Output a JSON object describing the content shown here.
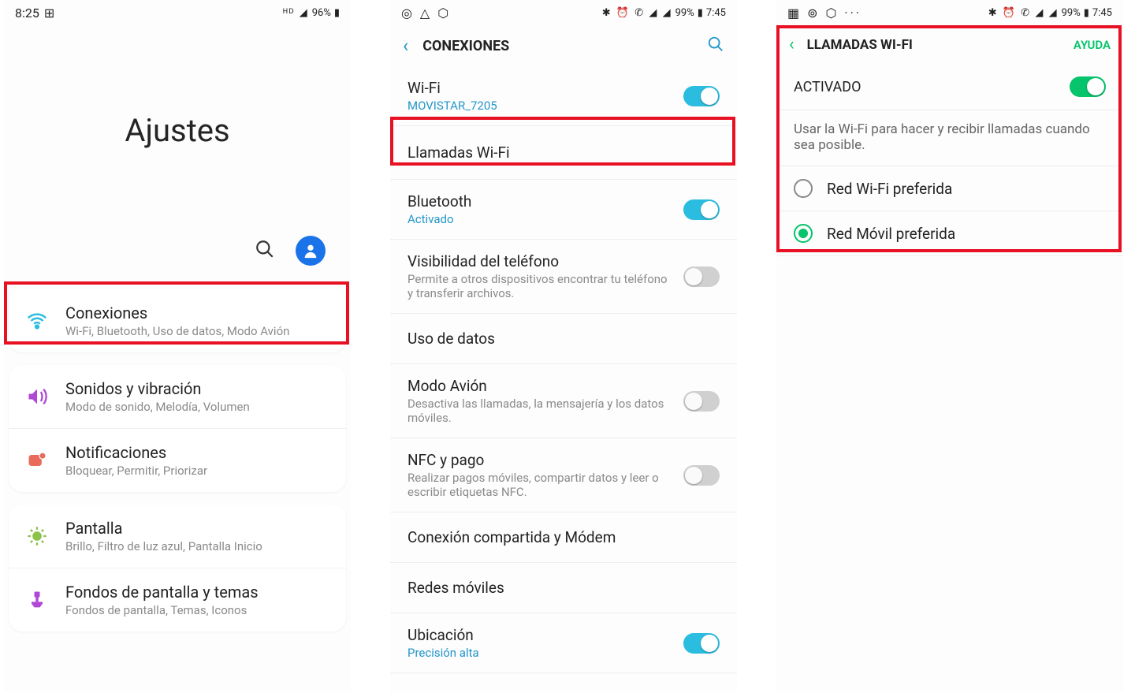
{
  "phone1": {
    "status": {
      "time": "8:25",
      "battery": "96%"
    },
    "title": "Ajustes",
    "items": [
      {
        "title": "Conexiones",
        "sub": "Wi-Fi, Bluetooth, Uso de datos, Modo Avión"
      },
      {
        "title": "Sonidos y vibración",
        "sub": "Modo de sonido, Melodía, Volumen"
      },
      {
        "title": "Notificaciones",
        "sub": "Bloquear, Permitir, Priorizar"
      },
      {
        "title": "Pantalla",
        "sub": "Brillo, Filtro de luz azul, Pantalla Inicio"
      },
      {
        "title": "Fondos de pantalla y temas",
        "sub": "Fondos de pantalla, Temas, Iconos"
      }
    ]
  },
  "phone2": {
    "status": {
      "battery": "99%",
      "time": "7:45"
    },
    "header": "CONEXIONES",
    "items": [
      {
        "title": "Wi-Fi",
        "sub": "MOVISTAR_7205",
        "accent": true,
        "toggle": "on"
      },
      {
        "title": "Llamadas Wi-Fi"
      },
      {
        "title": "Bluetooth",
        "sub": "Activado",
        "accent": true,
        "toggle": "on"
      },
      {
        "title": "Visibilidad del teléfono",
        "sub": "Permite a otros dispositivos encontrar tu teléfono y transferir archivos.",
        "toggle": "off"
      },
      {
        "title": "Uso de datos"
      },
      {
        "title": "Modo Avión",
        "sub": "Desactiva las llamadas, la mensajería y los datos móviles.",
        "toggle": "off"
      },
      {
        "title": "NFC y pago",
        "sub": "Realizar pagos móviles, compartir datos y leer o escribir etiquetas NFC.",
        "toggle": "off"
      },
      {
        "title": "Conexión compartida y Módem"
      },
      {
        "title": "Redes móviles"
      },
      {
        "title": "Ubicación",
        "sub": "Precisión alta",
        "accent": true,
        "toggle": "on"
      }
    ]
  },
  "phone3": {
    "status": {
      "battery": "99%",
      "time": "7:45"
    },
    "header": "LLAMADAS WI-FI",
    "help": "AYUDA",
    "activado": "ACTIVADO",
    "desc": "Usar la Wi-Fi para hacer y recibir llamadas cuando sea posible.",
    "options": [
      {
        "label": "Red Wi-Fi preferida",
        "selected": false
      },
      {
        "label": "Red Móvil preferida",
        "selected": true
      }
    ]
  }
}
